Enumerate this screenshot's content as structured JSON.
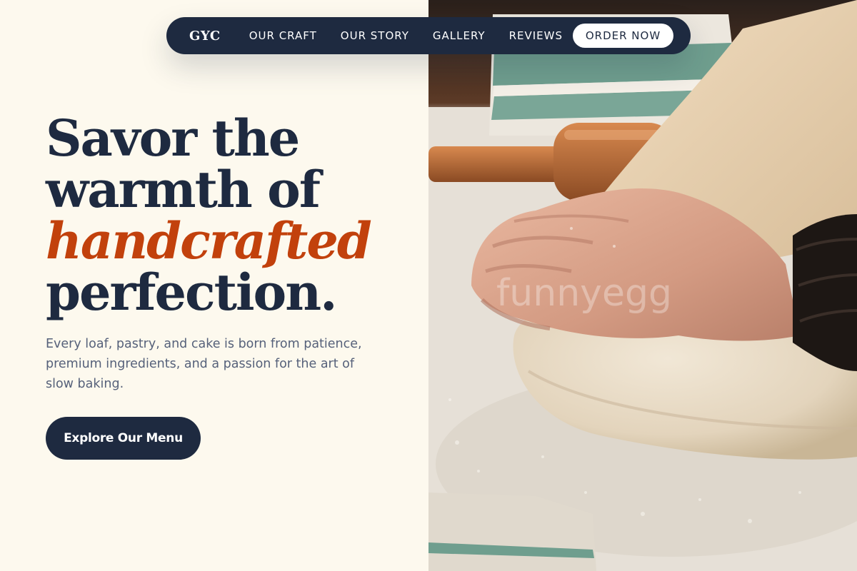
{
  "nav": {
    "logo": "GYC",
    "links": [
      "OUR CRAFT",
      "OUR STORY",
      "GALLERY",
      "REVIEWS"
    ],
    "cta": "ORDER NOW"
  },
  "hero": {
    "headline_line1": "Savor the",
    "headline_line2": "warmth of",
    "headline_accent": "handcrafted",
    "headline_line4": "perfection.",
    "subcopy": "Every loaf, pastry, and cake is born from patience, premium ingredients, and a passion for the art of slow baking.",
    "cta": "Explore Our Menu"
  },
  "image": {
    "subject": "baker-hands-kneading-dough-photo",
    "watermark": "funnyegg"
  },
  "colors": {
    "background": "#fdf9ee",
    "navy": "#1e2a40",
    "accent": "#c2410c",
    "body_text": "#56617a"
  }
}
